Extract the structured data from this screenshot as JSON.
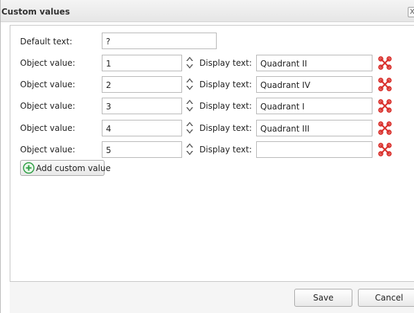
{
  "dialog": {
    "title": "Custom values",
    "close_label": "X"
  },
  "form": {
    "default_text_label": "Default text:",
    "default_text_value": "?",
    "object_value_label": "Object value:",
    "display_text_label": "Display text:",
    "rows": [
      {
        "object_value": "1",
        "display_text": "Quadrant II"
      },
      {
        "object_value": "2",
        "display_text": "Quadrant IV"
      },
      {
        "object_value": "3",
        "display_text": "Quadrant I"
      },
      {
        "object_value": "4",
        "display_text": "Quadrant III"
      },
      {
        "object_value": "5",
        "display_text": ""
      }
    ],
    "add_button_label": "Add custom value"
  },
  "footer": {
    "save_label": "Save",
    "cancel_label": "Cancel"
  },
  "colors": {
    "delete_icon": "#d9302c",
    "add_icon": "#2e9e44"
  }
}
